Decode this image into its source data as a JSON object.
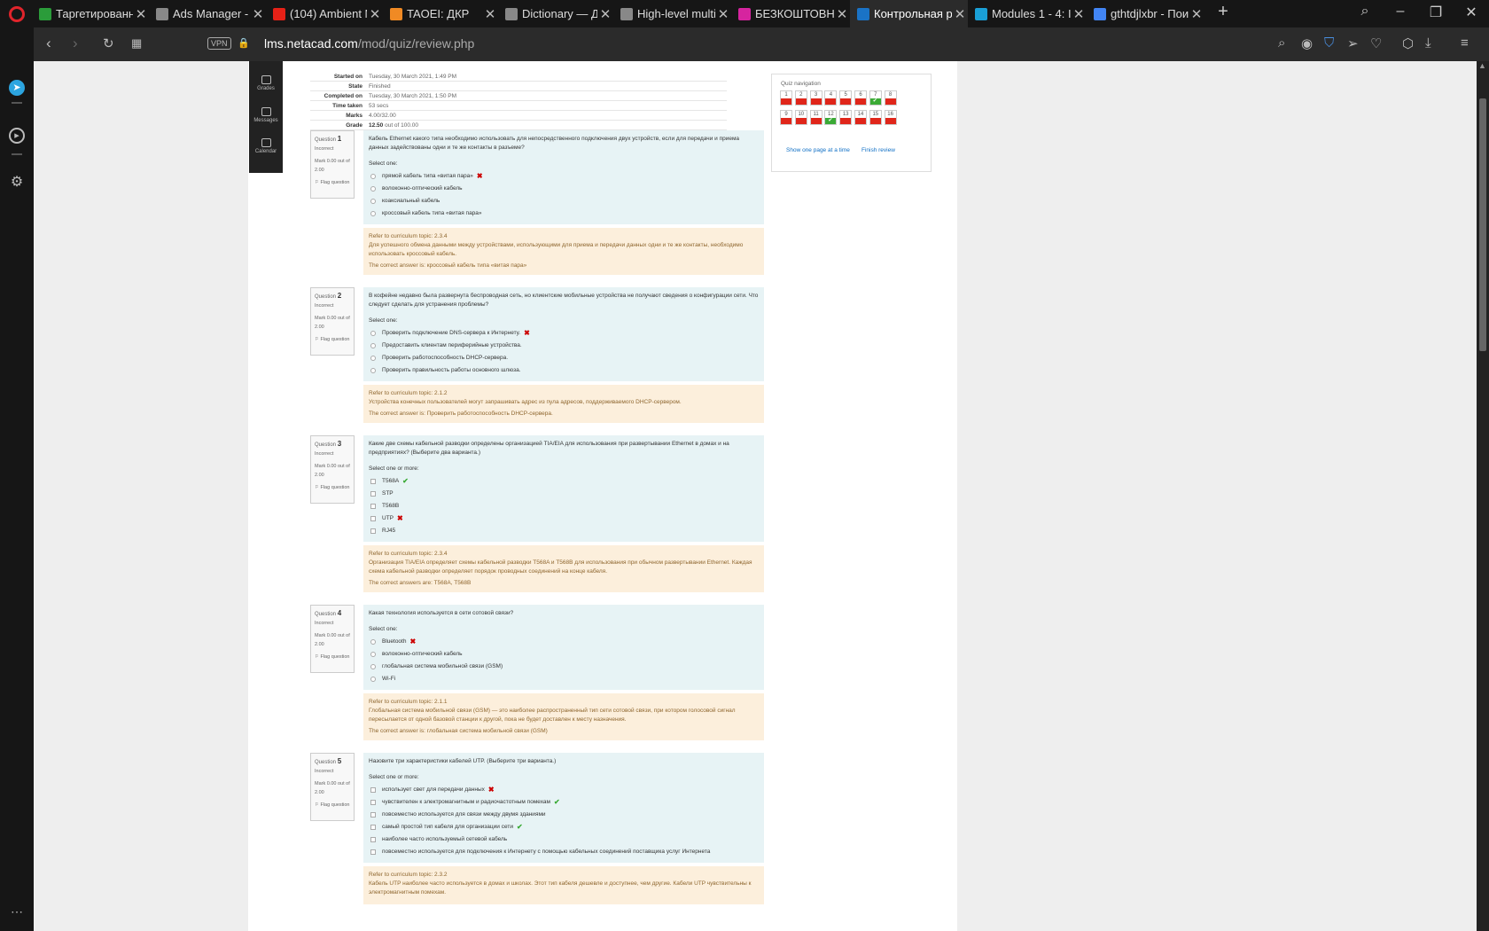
{
  "browser": {
    "tabs": [
      {
        "label": "Таргетированна",
        "favicon_color": "#2b9c3a",
        "active": false
      },
      {
        "label": "Ads Manager - У",
        "favicon_color": "#888888",
        "active": false
      },
      {
        "label": "(104) Ambient M",
        "favicon_color": "#e62117",
        "active": false
      },
      {
        "label": "TAOEI: ДКР",
        "favicon_color": "#f08a24",
        "active": false
      },
      {
        "label": "Dictionary — До",
        "favicon_color": "#888888",
        "active": false
      },
      {
        "label": "High-level multip",
        "favicon_color": "#888888",
        "active": false
      },
      {
        "label": "БЕЗКОШТОВНИ",
        "favicon_color": "#d6249f",
        "active": false
      },
      {
        "label": "Контрольная ра",
        "favicon_color": "#1a73c6",
        "active": true
      },
      {
        "label": "Modules 1 - 4: In",
        "favicon_color": "#1a9fd6",
        "active": false
      },
      {
        "label": "gthtdjlxbr - Пои",
        "favicon_color": "#4285f4",
        "active": false
      }
    ],
    "new_tab_label": "+",
    "vpn_label": "VPN",
    "url_host": "lms.netacad.com",
    "url_path": "/mod/quiz/review.php"
  },
  "drawer": {
    "items": [
      {
        "label": "Home"
      },
      {
        "label": "Grades"
      },
      {
        "label": "Messages"
      },
      {
        "label": "Calendar"
      }
    ]
  },
  "summary": {
    "rows": [
      {
        "key": "Started on",
        "value": "Tuesday, 30 March 2021, 1:49 PM"
      },
      {
        "key": "State",
        "value": "Finished"
      },
      {
        "key": "Completed on",
        "value": "Tuesday, 30 March 2021, 1:50 PM"
      },
      {
        "key": "Time taken",
        "value": "53 secs"
      },
      {
        "key": "Marks",
        "value": "4.00/32.00"
      }
    ],
    "grade_key": "Grade",
    "grade_bold": "12.50",
    "grade_rest": " out of 100.00"
  },
  "quiz_nav": {
    "title": "Quiz navigation",
    "buttons": [
      {
        "n": "1",
        "correct": false
      },
      {
        "n": "2",
        "correct": false
      },
      {
        "n": "3",
        "correct": false
      },
      {
        "n": "4",
        "correct": false
      },
      {
        "n": "5",
        "correct": false
      },
      {
        "n": "6",
        "correct": false
      },
      {
        "n": "7",
        "correct": true
      },
      {
        "n": "8",
        "correct": false
      },
      {
        "n": "9",
        "correct": false
      },
      {
        "n": "10",
        "correct": false
      },
      {
        "n": "11",
        "correct": false
      },
      {
        "n": "12",
        "correct": true
      },
      {
        "n": "13",
        "correct": false
      },
      {
        "n": "14",
        "correct": false
      },
      {
        "n": "15",
        "correct": false
      },
      {
        "n": "16",
        "correct": false
      }
    ],
    "show_one_page": "Show one page at a time",
    "finish_review": "Finish review"
  },
  "questions": [
    {
      "word": "Question",
      "number": "1",
      "state": "Incorrect",
      "mark": "Mark 0.00 out of 2.00",
      "flag": "Flag question",
      "text": "Кабель Ethernet какого типа необходимо использовать для непосредственного подключения двух устройств, если для передачи и приема данных задействованы одни и те же контакты в разъеме?",
      "prompt": "Select one:",
      "input": "radio",
      "answers": [
        {
          "text": "прямой кабель типа «витая пара»",
          "mark": "x"
        },
        {
          "text": "волоконно-оптический кабель",
          "mark": ""
        },
        {
          "text": "коаксиальный кабель",
          "mark": ""
        },
        {
          "text": "кроссовый кабель типа «витая пара»",
          "mark": ""
        }
      ],
      "refer": "Refer to curriculum topic: 2.3.4",
      "explanation": "Для успешного обмена данными между устройствами, использующими для приема и передачи данных одни и те же контакты, необходимо использовать кроссовый кабель.",
      "correct": "The correct answer is: кроссовый кабель типа «витая пара»"
    },
    {
      "word": "Question",
      "number": "2",
      "state": "Incorrect",
      "mark": "Mark 0.00 out of 2.00",
      "flag": "Flag question",
      "text": "В кофейне недавно была развернута беспроводная сеть, но клиентские мобильные устройства не получают сведения о конфигурации сети. Что следует сделать для устранения проблемы?",
      "prompt": "Select one:",
      "input": "radio",
      "answers": [
        {
          "text": "Проверить подключение DNS-сервера к Интернету.",
          "mark": "x"
        },
        {
          "text": "Предоставить клиентам периферийные устройства.",
          "mark": ""
        },
        {
          "text": "Проверить работоспособность DHCP-сервера.",
          "mark": ""
        },
        {
          "text": "Проверить правильность работы основного шлюза.",
          "mark": ""
        }
      ],
      "refer": "Refer to curriculum topic: 2.1.2",
      "explanation": "Устройства конечных пользователей могут запрашивать адрес из пула адресов, поддерживаемого DHCP-сервером.",
      "correct": "The correct answer is: Проверить работоспособность DHCP-сервера."
    },
    {
      "word": "Question",
      "number": "3",
      "state": "Incorrect",
      "mark": "Mark 0.00 out of 2.00",
      "flag": "Flag question",
      "text": "Какие две схемы кабельной разводки определены организацией TIA/EIA для использования при развертывании Ethernet в домах и на предприятиях? (Выберите два варианта.)",
      "prompt": "Select one or more:",
      "input": "checkbox",
      "answers": [
        {
          "text": "T568A",
          "mark": "ok"
        },
        {
          "text": "STP",
          "mark": ""
        },
        {
          "text": "T568B",
          "mark": ""
        },
        {
          "text": "UTP",
          "mark": "x"
        },
        {
          "text": "RJ45",
          "mark": ""
        }
      ],
      "refer": "Refer to curriculum topic: 2.3.4",
      "explanation": "Организация TIA/EIA определяет схемы кабельной разводки T568A и T568B для использования при обычном развертывании Ethernet. Каждая схема кабельной разводки определяет порядок проводных соединений на конце кабеля.",
      "correct": "The correct answers are: T568A, T568B"
    },
    {
      "word": "Question",
      "number": "4",
      "state": "Incorrect",
      "mark": "Mark 0.00 out of 2.00",
      "flag": "Flag question",
      "text": "Какая технология используется в сети сотовой связи?",
      "prompt": "Select one:",
      "input": "radio",
      "answers": [
        {
          "text": "Bluetooth",
          "mark": "x"
        },
        {
          "text": "волоконно-оптический кабель",
          "mark": ""
        },
        {
          "text": "глобальная система мобильной связи (GSM)",
          "mark": ""
        },
        {
          "text": "Wi-Fi",
          "mark": ""
        }
      ],
      "refer": "Refer to curriculum topic: 2.1.1",
      "explanation": "Глобальная система мобильной связи (GSM) — это наиболее распространенный тип сети сотовой связи, при котором голосовой сигнал пересылается от одной базовой станции к другой, пока не будет доставлен к месту назначения.",
      "correct": "The correct answer is: глобальная система мобильной связи (GSM)"
    },
    {
      "word": "Question",
      "number": "5",
      "state": "Incorrect",
      "mark": "Mark 0.00 out of 2.00",
      "flag": "Flag question",
      "text": "Назовите три характеристики кабелей UTP. (Выберите три варианта.)",
      "prompt": "Select one or more:",
      "input": "checkbox",
      "answers": [
        {
          "text": "использует свет для передачи данных",
          "mark": "x"
        },
        {
          "text": "чувствителен к электромагнитным и радиочастотным помехам",
          "mark": "ok"
        },
        {
          "text": "повсеместно используется для связи между двумя зданиями",
          "mark": ""
        },
        {
          "text": "самый простой тип кабеля для организации сети",
          "mark": "ok"
        },
        {
          "text": "наиболее часто используемый сетевой кабель",
          "mark": ""
        },
        {
          "text": "повсеместно используется для подключения к Интернету с помощью кабельных соединений поставщика услуг Интернета",
          "mark": ""
        }
      ],
      "refer": "Refer to curriculum topic: 2.3.2",
      "explanation": "Кабель UTP наиболее часто используется в домах и школах. Этот тип кабеля дешевле и доступнее, чем другие. Кабели UTP чувствительны к электромагнитным помехам.",
      "correct": ""
    }
  ]
}
